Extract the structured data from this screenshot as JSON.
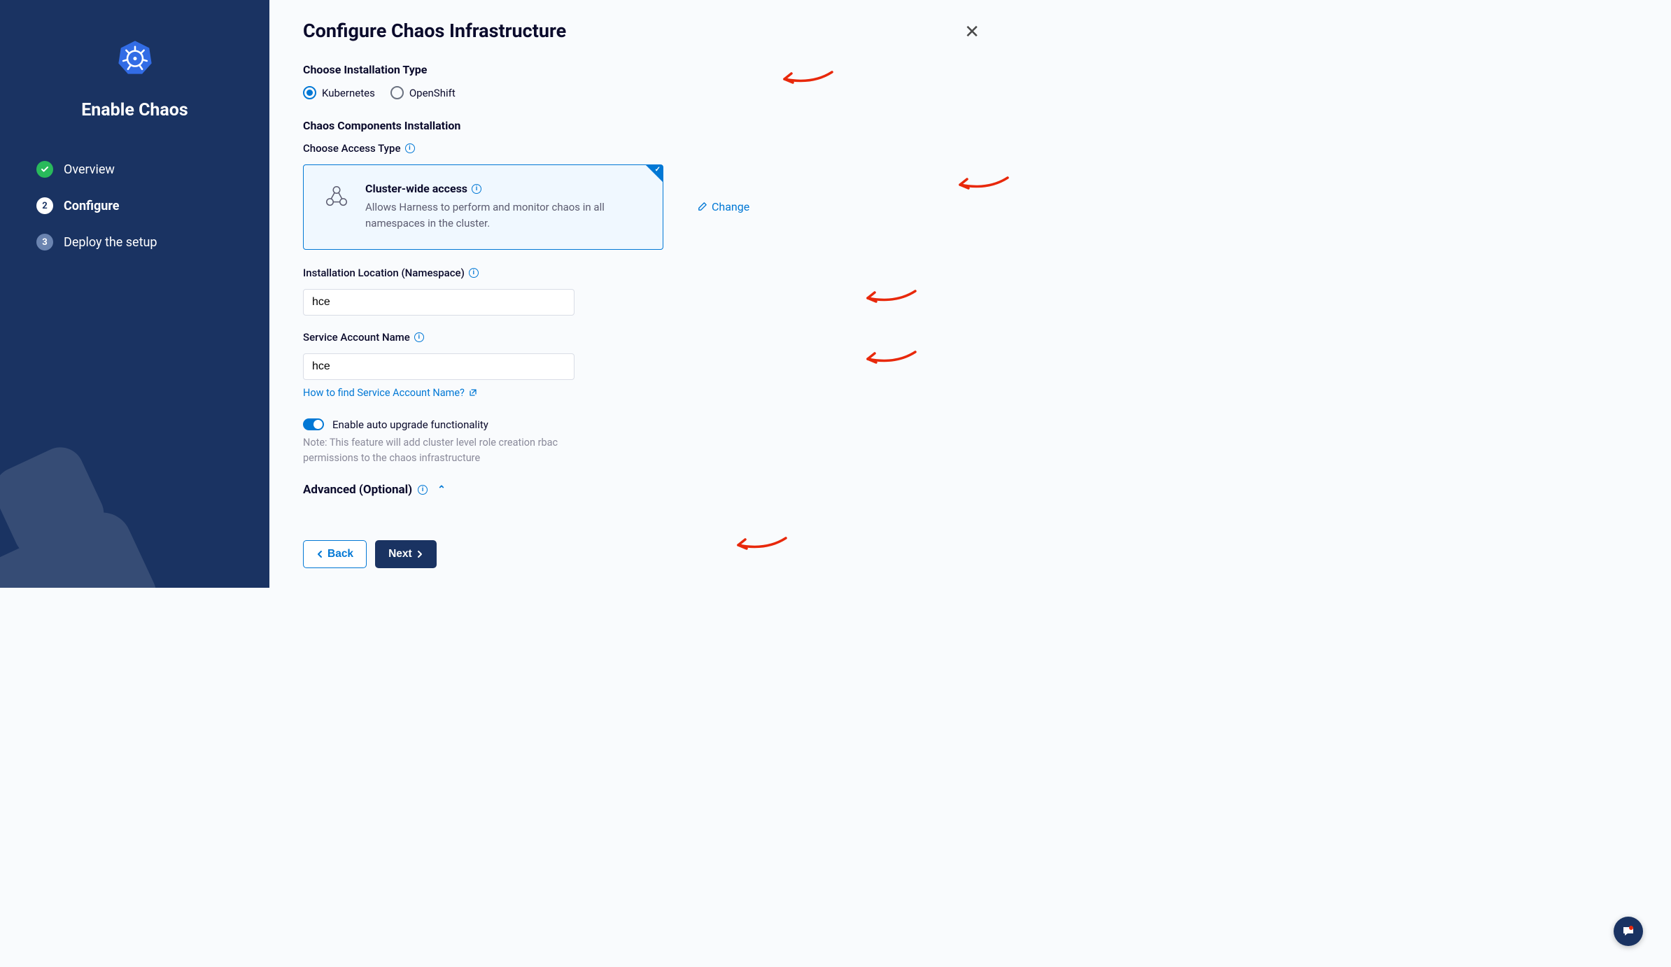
{
  "sidebar": {
    "title": "Enable Chaos",
    "steps": [
      {
        "label": "Overview",
        "state": "done",
        "badge": "✓"
      },
      {
        "label": "Configure",
        "state": "active",
        "badge": "2"
      },
      {
        "label": "Deploy the setup",
        "state": "pending",
        "badge": "3"
      }
    ]
  },
  "page": {
    "title": "Configure Chaos Infrastructure",
    "install_type_heading": "Choose Installation Type",
    "install_types": [
      {
        "label": "Kubernetes",
        "selected": true
      },
      {
        "label": "OpenShift",
        "selected": false
      }
    ],
    "components_heading": "Chaos Components Installation",
    "access_type_label": "Choose Access Type",
    "access_card": {
      "title": "Cluster-wide access",
      "desc": "Allows Harness to perform and monitor chaos in all namespaces in the cluster."
    },
    "change_label": "Change",
    "namespace_label": "Installation Location (Namespace)",
    "namespace_value": "hce",
    "service_account_label": "Service Account Name",
    "service_account_value": "hce",
    "service_account_help": "How to find Service Account Name?",
    "toggle_label": "Enable auto upgrade functionality",
    "toggle_note": "Note: This feature will add cluster level role creation rbac permissions to the chaos infrastructure",
    "advanced_label": "Advanced (Optional)",
    "back_label": "Back",
    "next_label": "Next"
  }
}
